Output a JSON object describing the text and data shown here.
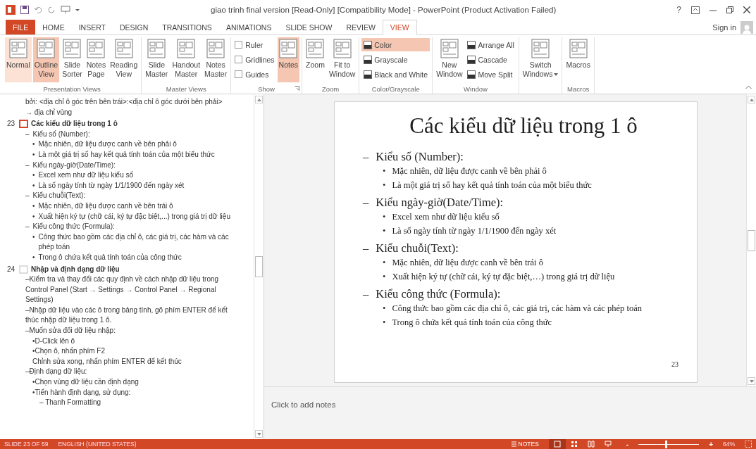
{
  "window": {
    "title": "giao trinh final version [Read-Only] [Compatibility Mode] - PowerPoint (Product Activation Failed)",
    "help": "?"
  },
  "tabs": [
    {
      "label": "FILE",
      "kind": "file",
      "selected": false
    },
    {
      "label": "HOME",
      "kind": "tab",
      "selected": false
    },
    {
      "label": "INSERT",
      "kind": "tab",
      "selected": false
    },
    {
      "label": "DESIGN",
      "kind": "tab",
      "selected": false
    },
    {
      "label": "TRANSITIONS",
      "kind": "tab",
      "selected": false
    },
    {
      "label": "ANIMATIONS",
      "kind": "tab",
      "selected": false
    },
    {
      "label": "SLIDE SHOW",
      "kind": "tab",
      "selected": false
    },
    {
      "label": "REVIEW",
      "kind": "tab",
      "selected": false
    },
    {
      "label": "VIEW",
      "kind": "tab",
      "selected": true
    }
  ],
  "account": {
    "label": "Sign in"
  },
  "ribbon": {
    "groups": [
      {
        "label": "Presentation Views",
        "items": [
          {
            "kind": "large",
            "lines": [
              "Normal"
            ],
            "selected": false,
            "hover": true
          },
          {
            "kind": "large",
            "lines": [
              "Outline",
              "View"
            ],
            "selected": true
          },
          {
            "kind": "large",
            "lines": [
              "Slide",
              "Sorter"
            ],
            "selected": false
          },
          {
            "kind": "large",
            "lines": [
              "Notes",
              "Page"
            ],
            "selected": false
          },
          {
            "kind": "large",
            "lines": [
              "Reading",
              "View"
            ],
            "selected": false
          }
        ]
      },
      {
        "label": "Master Views",
        "items": [
          {
            "kind": "large",
            "lines": [
              "Slide",
              "Master"
            ],
            "selected": false
          },
          {
            "kind": "large",
            "lines": [
              "Handout",
              "Master"
            ],
            "selected": false
          },
          {
            "kind": "large",
            "lines": [
              "Notes",
              "Master"
            ],
            "selected": false
          }
        ]
      },
      {
        "label": "Show",
        "launcher": true,
        "items": [
          {
            "kind": "check",
            "label": "Ruler",
            "checked": false
          },
          {
            "kind": "check",
            "label": "Gridlines",
            "checked": false
          },
          {
            "kind": "check",
            "label": "Guides",
            "checked": false
          },
          {
            "kind": "large",
            "lines": [
              "Notes"
            ],
            "selected": true
          }
        ]
      },
      {
        "label": "Zoom",
        "items": [
          {
            "kind": "large",
            "lines": [
              "Zoom"
            ],
            "selected": false
          },
          {
            "kind": "large",
            "lines": [
              "Fit to",
              "Window"
            ],
            "selected": false
          }
        ]
      },
      {
        "label": "Color/Grayscale",
        "items": [
          {
            "kind": "small",
            "label": "Color",
            "selected": true
          },
          {
            "kind": "small",
            "label": "Grayscale",
            "selected": false
          },
          {
            "kind": "small",
            "label": "Black and White",
            "selected": false
          }
        ]
      },
      {
        "label": "Window",
        "items": [
          {
            "kind": "large",
            "lines": [
              "New",
              "Window"
            ],
            "selected": false
          },
          {
            "kind": "small",
            "label": "Arrange All",
            "selected": false
          },
          {
            "kind": "small",
            "label": "Cascade",
            "selected": false
          },
          {
            "kind": "small",
            "label": "Move Split",
            "selected": false
          }
        ]
      },
      {
        "items": [
          {
            "kind": "large",
            "lines": [
              "Switch",
              "Windows"
            ],
            "selected": false,
            "dropdown": true
          }
        ]
      },
      {
        "label": "Macros",
        "items": [
          {
            "kind": "large",
            "lines": [
              "Macros"
            ],
            "selected": false
          }
        ]
      }
    ]
  },
  "outline": {
    "slides": [
      {
        "lines": [
          {
            "text": "bởi: <địa chỉ ô góc trên bên trái>:<địa chỉ ô góc dưới bên phải>"
          },
          {
            "text": "→ địa chỉ vùng"
          }
        ]
      },
      {
        "number": "23",
        "title": "Các kiểu dữ liệu trong 1 ô",
        "selected": true,
        "lines": [
          {
            "marker": "–",
            "text": "Kiểu số (Number):",
            "children": [
              {
                "marker": "•",
                "text": "Mặc nhiên, dữ liệu được canh về bên phải ô"
              },
              {
                "marker": "•",
                "text": "Là một giá trị số hay kết quả tính toán của một biểu thức"
              }
            ]
          },
          {
            "marker": "–",
            "text": "Kiểu ngày-giờ(Date/Time):",
            "children": [
              {
                "marker": "•",
                "text": "Excel xem như dữ liệu kiểu số"
              },
              {
                "marker": "•",
                "text": "Là số ngày tính từ ngày 1/1/1900 đến ngày xét"
              }
            ]
          },
          {
            "marker": "–",
            "text": "Kiểu chuỗi(Text):",
            "children": [
              {
                "marker": "•",
                "text": "Mặc nhiên, dữ liệu được canh về bên trái ô"
              },
              {
                "marker": "•",
                "text": "Xuất hiện ký tự (chữ cái, ký tự đặc biệt,...) trong giá trị dữ liệu"
              }
            ]
          },
          {
            "marker": "–",
            "text": "Kiểu công thức (Formula):",
            "children": [
              {
                "marker": "•",
                "text": "Công thức bao gồm các địa chỉ ô, các giá trị, các hàm và các phép toán"
              },
              {
                "marker": "•",
                "text": "Trong ô chứa kết quả tính toán của công thức"
              }
            ]
          }
        ]
      },
      {
        "number": "24",
        "title": "Nhập và định dạng dữ liệu",
        "selected": false,
        "lines": [
          {
            "text": "–Kiểm tra và thay đổi các quy định về cách nhập dữ liệu trong Control Panel (Start → Settings → Control Panel → Regional Settings)"
          },
          {
            "text": "–Nhập dữ liệu vào các ô trong bảng tính, gõ phím ENTER để kết thúc nhập dữ liệu trong 1 ô."
          },
          {
            "text": "–Muốn sửa đổi dữ liệu nhập:",
            "children": [
              {
                "text": "•D-Click lên ô"
              },
              {
                "text": "•Chọn ô, nhấn phím F2"
              },
              {
                "text": "Chỉnh sửa xong, nhấn phím ENTER để kết thúc"
              }
            ]
          },
          {
            "text": "–Định dạng dữ liệu:",
            "children": [
              {
                "text": "•Chọn vùng dữ liệu cần định dạng"
              },
              {
                "text": "•Tiến hành định dạng, sử dụng:",
                "children": [
                  {
                    "text": "– Thanh Formatting"
                  }
                ]
              }
            ]
          }
        ]
      }
    ]
  },
  "slide": {
    "title": "Các kiểu dữ liệu trong 1 ô",
    "number": "23",
    "items": [
      {
        "marker": "–",
        "text": "Kiểu số (Number):",
        "children": [
          {
            "marker": "•",
            "text": "Mặc nhiên, dữ liệu được canh về bên phải ô"
          },
          {
            "marker": "•",
            "text": "Là một giá trị số hay kết quả tính toán của một biểu thức"
          }
        ]
      },
      {
        "marker": "–",
        "text": "Kiểu ngày-giờ(Date/Time):",
        "children": [
          {
            "marker": "•",
            "text": "Excel xem như dữ liệu kiểu số"
          },
          {
            "marker": "•",
            "text": "Là số ngày tính từ ngày 1/1/1900 đến ngày xét"
          }
        ]
      },
      {
        "marker": "–",
        "text": "Kiểu chuỗi(Text):",
        "children": [
          {
            "marker": "•",
            "text": "Mặc nhiên, dữ liệu được canh về bên trái ô"
          },
          {
            "marker": "•",
            "text": "Xuất hiện ký tự (chữ cái, ký tự đặc biệt,…) trong giá trị dữ liệu"
          }
        ]
      },
      {
        "marker": "–",
        "text": "Kiểu công thức (Formula):",
        "children": [
          {
            "marker": "•",
            "text": "Công thức bao gồm các địa chỉ ô, các giá trị, các hàm và các phép toán"
          },
          {
            "marker": "•",
            "text": "Trong ô chứa kết quả tính toán của công thức"
          }
        ]
      }
    ]
  },
  "notes": {
    "placeholder": "Click to add notes"
  },
  "status_bar": {
    "slide": "SLIDE 23 OF 59",
    "language": "ENGLISH (UNITED STATES)",
    "notes": "NOTES",
    "views": [
      {
        "kind": "normal",
        "selected": true
      },
      {
        "kind": "sorter",
        "selected": false
      },
      {
        "kind": "reading",
        "selected": false
      },
      {
        "kind": "slideshow",
        "selected": false
      }
    ],
    "minus": "-",
    "plus": "+",
    "zoom": {
      "level": 0.45
    },
    "zoom_label": "64%"
  }
}
